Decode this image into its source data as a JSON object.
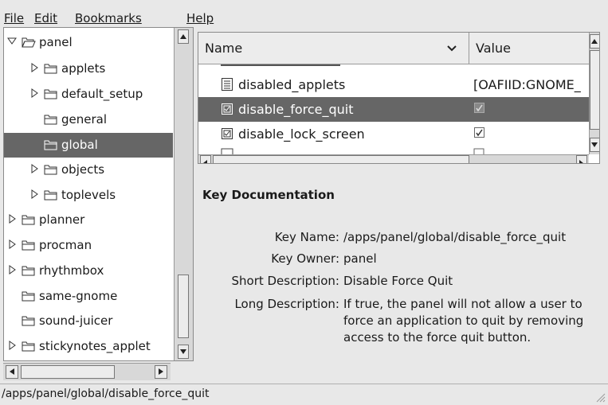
{
  "menu": {
    "file": "File",
    "edit": "Edit",
    "bookmarks": "Bookmarks",
    "help": "Help"
  },
  "tree": {
    "items": [
      {
        "label": "panel",
        "expanded": true,
        "selected": false
      },
      {
        "label": "applets",
        "expanded": false,
        "selected": false
      },
      {
        "label": "default_setup",
        "expanded": false,
        "selected": false
      },
      {
        "label": "general",
        "selected": false
      },
      {
        "label": "global",
        "selected": true
      },
      {
        "label": "objects",
        "expanded": false,
        "selected": false
      },
      {
        "label": "toplevels",
        "expanded": false,
        "selected": false
      },
      {
        "label": "planner",
        "expanded": false,
        "selected": false
      },
      {
        "label": "procman",
        "expanded": false,
        "selected": false
      },
      {
        "label": "rhythmbox",
        "expanded": false,
        "selected": false
      },
      {
        "label": "same-gnome",
        "selected": false
      },
      {
        "label": "sound-juicer",
        "selected": false
      },
      {
        "label": "stickynotes_applet",
        "expanded": false,
        "selected": false
      }
    ]
  },
  "list": {
    "columns": {
      "name": "Name",
      "value": "Value"
    },
    "rows": [
      {
        "name": "disabled_applets",
        "value": "[OAFIID:GNOME_",
        "icon": "list-key-icon"
      },
      {
        "name": "disable_force_quit",
        "value": "✓",
        "icon": "bool-key-icon",
        "selected": true
      },
      {
        "name": "disable_lock_screen",
        "value": "✓",
        "icon": "bool-key-icon"
      }
    ]
  },
  "doc": {
    "title": "Key Documentation",
    "key_name_label": "Key Name:",
    "key_name_value": "/apps/panel/global/disable_force_quit",
    "key_owner_label": "Key Owner:",
    "key_owner_value": "panel",
    "short_label": "Short Description:",
    "short_value": "Disable Force Quit",
    "long_label": "Long Description:",
    "long_value_line1": "If true, the panel will not allow a user to",
    "long_value_line2": "force an application to quit by removing",
    "long_value_line3": "access to the force quit button."
  },
  "status": {
    "path": "/apps/panel/global/disable_force_quit"
  },
  "colors": {
    "selection": "#666666",
    "background": "#e8e8e8"
  }
}
